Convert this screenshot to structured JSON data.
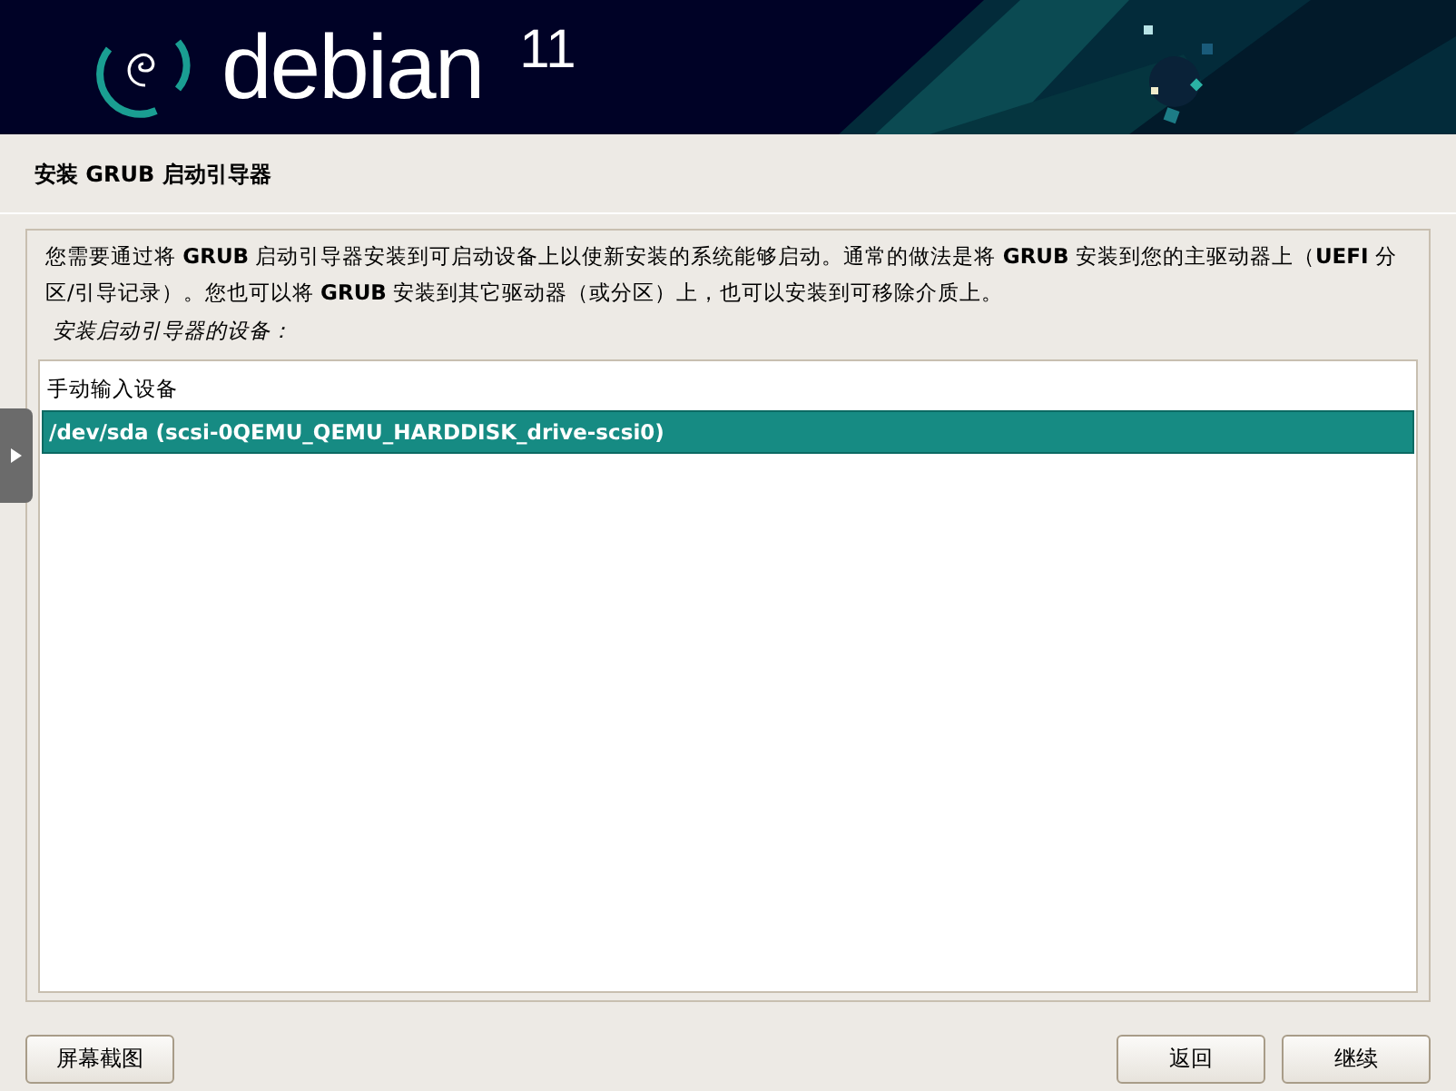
{
  "banner": {
    "wordmark": "debian",
    "version": "11"
  },
  "title": "安装 GRUB 启动引导器",
  "description": "您需要通过将 **GRUB** 启动引导器安装到可启动设备上以使新安装的系统能够启动。通常的做法是将 **GRUB** 安装到您的主驱动器上（**UEFI** 分区/引导记录）。您也可以将 **GRUB** 安装到其它驱动器（或分区）上，也可以安装到可移除介质上。",
  "prompt": "安装启动引导器的设备：",
  "devices": [
    {
      "label": "手动输入设备",
      "selected": false
    },
    {
      "label": "/dev/sda  (scsi-0QEMU_QEMU_HARDDISK_drive-scsi0)",
      "selected": true
    }
  ],
  "buttons": {
    "left": [
      "屏幕截图"
    ],
    "right": [
      "返回",
      "继续"
    ]
  }
}
